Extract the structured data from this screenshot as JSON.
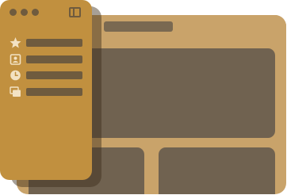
{
  "window": {
    "accent_color": "#c1903f",
    "background_color": "#c9a36a",
    "content_color": "#706250"
  },
  "sidebar": {
    "items": [
      {
        "icon": "star-icon"
      },
      {
        "icon": "contact-card-icon"
      },
      {
        "icon": "clock-icon"
      },
      {
        "icon": "stacked-windows-icon"
      }
    ]
  }
}
